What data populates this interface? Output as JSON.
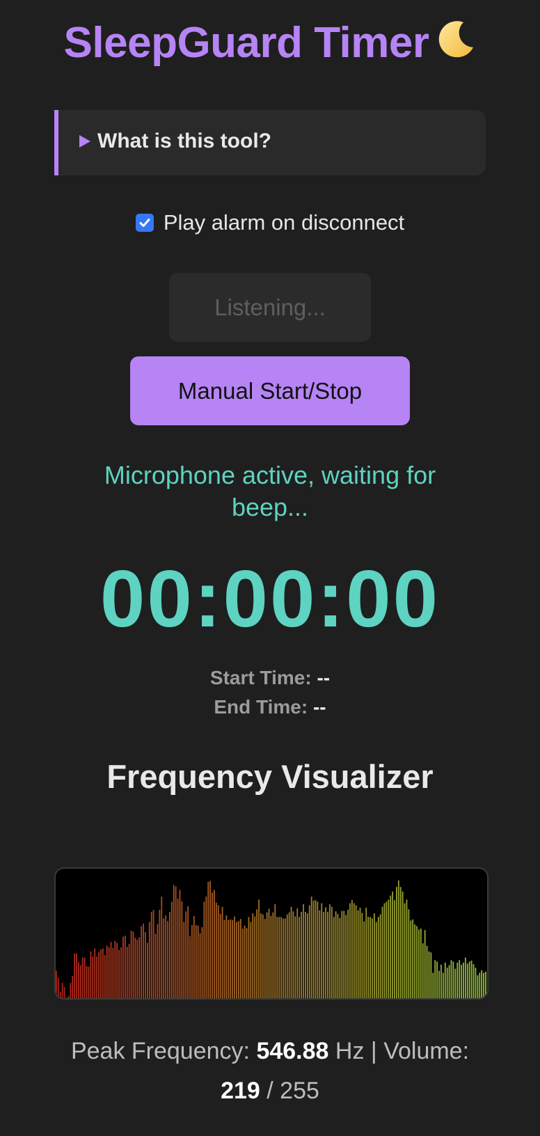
{
  "header": {
    "title": "SleepGuard Timer",
    "title_icon": "crescent-moon-icon",
    "accent_color": "#b684f5"
  },
  "info": {
    "summary_label": "What is this tool?",
    "expanded": false
  },
  "alarm_option": {
    "label": "Play alarm on disconnect",
    "checked": true
  },
  "buttons": {
    "listen_label": "Listening...",
    "listen_disabled": true,
    "manual_label": "Manual Start/Stop"
  },
  "status": {
    "message": "Microphone active, waiting for beep...",
    "color": "#5ed3c2"
  },
  "timer": {
    "display": "00:00:00",
    "start_label": "Start Time:",
    "start_value": "--",
    "end_label": "End Time:",
    "end_value": "--"
  },
  "visualizer": {
    "heading": "Frequency Visualizer",
    "color_low": "#b0221a",
    "color_high": "#8fc132",
    "max_level": 255,
    "levels": [
      54,
      40,
      12,
      30,
      22,
      1,
      4,
      30,
      44,
      88,
      88,
      71,
      65,
      80,
      80,
      63,
      62,
      92,
      82,
      98,
      82,
      91,
      96,
      98,
      85,
      104,
      100,
      111,
      99,
      113,
      109,
      95,
      100,
      121,
      123,
      101,
      107,
      133,
      131,
      119,
      115,
      120,
      142,
      147,
      130,
      109,
      150,
      170,
      174,
      127,
      146,
      174,
      200,
      157,
      163,
      152,
      170,
      190,
      223,
      220,
      196,
      213,
      191,
      150,
      171,
      181,
      122,
      144,
      162,
      144,
      143,
      128,
      140,
      190,
      200,
      229,
      231,
      208,
      213,
      188,
      183,
      166,
      180,
      154,
      163,
      154,
      155,
      154,
      161,
      150,
      152,
      156,
      137,
      143,
      138,
      160,
      150,
      167,
      161,
      175,
      194,
      167,
      165,
      156,
      169,
      176,
      162,
      169,
      185,
      160,
      160,
      160,
      157,
      157,
      165,
      169,
      180,
      171,
      161,
      177,
      160,
      170,
      185,
      170,
      167,
      183,
      200,
      192,
      193,
      190,
      173,
      187,
      170,
      179,
      170,
      185,
      180,
      160,
      171,
      166,
      158,
      172,
      172,
      164,
      174,
      187,
      193,
      187,
      183,
      173,
      178,
      168,
      151,
      178,
      160,
      160,
      157,
      167,
      150,
      160,
      165,
      180,
      187,
      190,
      194,
      202,
      210,
      193,
      219,
      232,
      219,
      210,
      187,
      194,
      175,
      153,
      155,
      145,
      142,
      135,
      137,
      108,
      134,
      103,
      92,
      90,
      50,
      75,
      72,
      54,
      66,
      50,
      70,
      60,
      65,
      75,
      72,
      58,
      70,
      75,
      66,
      70,
      80,
      68,
      72,
      74,
      67,
      60,
      45,
      50,
      55,
      50,
      52
    ]
  },
  "readout": {
    "peak_label": "Peak Frequency:",
    "peak_value": "546.88",
    "peak_unit": "Hz |",
    "volume_label": "Volume:",
    "volume_value": "219",
    "volume_max": "/ 255"
  }
}
